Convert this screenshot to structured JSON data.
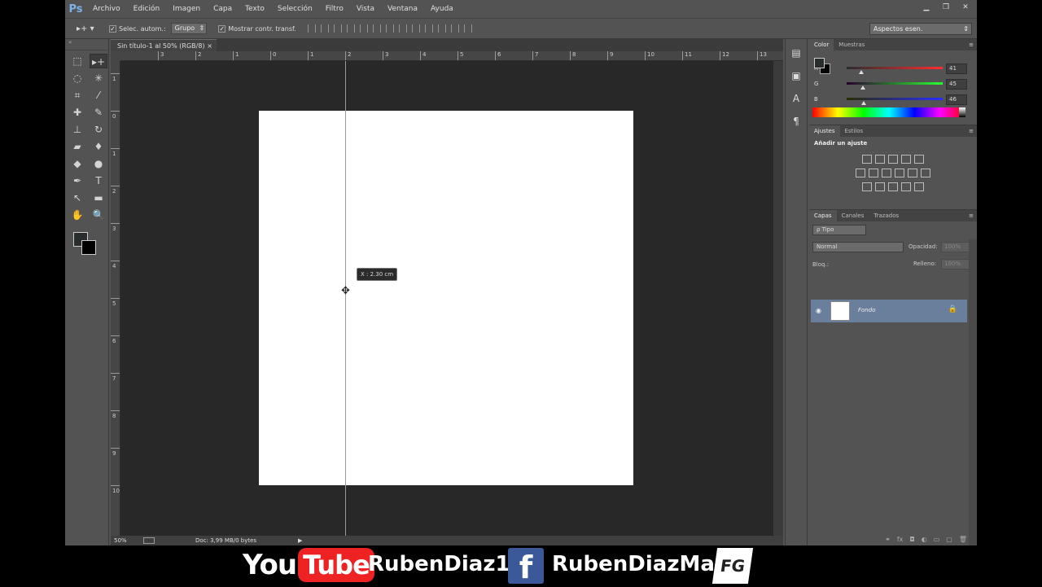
{
  "app": {
    "logo": "Ps"
  },
  "menu": [
    "Archivo",
    "Edición",
    "Imagen",
    "Capa",
    "Texto",
    "Selección",
    "Filtro",
    "Vista",
    "Ventana",
    "Ayuda"
  ],
  "window_controls": [
    "▁",
    "❐",
    "✕"
  ],
  "options": {
    "tool_glyph": "▸+ ▾",
    "auto_select_label": "Selec. autom.:",
    "auto_select_checked": "✓",
    "group_value": "Grupo",
    "show_transform_label": "Mostrar contr. transf.",
    "show_transform_checked": "✓",
    "workspace": "Aspectos esen."
  },
  "document": {
    "tab_title": "Sin título-1 al 50% (RGB/8)",
    "tab_close": "×",
    "tooltip": "X :  2.30 cm",
    "h_ruler_labels": [
      "3",
      "2",
      "1",
      "0",
      "1",
      "2",
      "3",
      "4",
      "5",
      "6",
      "7",
      "8",
      "9",
      "10",
      "11",
      "12",
      "13"
    ],
    "v_ruler_labels": [
      "1",
      "0",
      "1",
      "2",
      "3",
      "4",
      "5",
      "6",
      "7",
      "8",
      "9",
      "10"
    ],
    "canvas_color": "#ffffff"
  },
  "status": {
    "zoom": "50%",
    "doc": "Doc: 3,99 MB/0 bytes",
    "arrow": "▶"
  },
  "tools": [
    {
      "name": "marquee-tool-icon",
      "glyph": "⬚"
    },
    {
      "name": "move-tool-icon",
      "glyph": "▸+",
      "active": true
    },
    {
      "name": "lasso-tool-icon",
      "glyph": "◌"
    },
    {
      "name": "magic-wand-icon",
      "glyph": "✳"
    },
    {
      "name": "crop-tool-icon",
      "glyph": "⌗"
    },
    {
      "name": "eyedropper-icon",
      "glyph": "⁄"
    },
    {
      "name": "healing-brush-icon",
      "glyph": "✚"
    },
    {
      "name": "brush-tool-icon",
      "glyph": "✎"
    },
    {
      "name": "clone-stamp-icon",
      "glyph": "⊥"
    },
    {
      "name": "history-brush-icon",
      "glyph": "↻"
    },
    {
      "name": "eraser-icon",
      "glyph": "▰"
    },
    {
      "name": "paint-bucket-icon",
      "glyph": "♦"
    },
    {
      "name": "blur-tool-icon",
      "glyph": "◆"
    },
    {
      "name": "dodge-tool-icon",
      "glyph": "●"
    },
    {
      "name": "pen-tool-icon",
      "glyph": "✒"
    },
    {
      "name": "type-tool-icon",
      "glyph": "T"
    },
    {
      "name": "path-select-icon",
      "glyph": "↖"
    },
    {
      "name": "rectangle-tool-icon",
      "glyph": "▬"
    },
    {
      "name": "hand-tool-icon",
      "glyph": "✋"
    },
    {
      "name": "zoom-tool-icon",
      "glyph": "🔍"
    }
  ],
  "color_panel": {
    "tabs": [
      "Color",
      "Muestras"
    ],
    "r_label": "R",
    "r_value": "41",
    "g_label": "G",
    "g_value": "45",
    "b_label": "B",
    "b_value": "46",
    "fg_color": "#292d2e"
  },
  "adjust_panel": {
    "tabs": [
      "Ajustes",
      "Estilos"
    ],
    "title": "Añadir un ajuste"
  },
  "layers_panel": {
    "tabs": [
      "Capas",
      "Canales",
      "Trazados"
    ],
    "filter": "ρ Tipo",
    "blend_mode": "Normal",
    "opacity_label": "Opacidad:",
    "opacity_value": "100%",
    "lock_label": "Bloq.:",
    "fill_label": "Relleno:",
    "fill_value": "100%",
    "layer_name": "Fondo"
  },
  "banner": {
    "yt_you": "You",
    "yt_tube": "Tube",
    "yt_channel": "RubenDiaz1",
    "fb_glyph": "f",
    "fb_name": "RubenDiazMa",
    "fg_logo": "FG"
  }
}
